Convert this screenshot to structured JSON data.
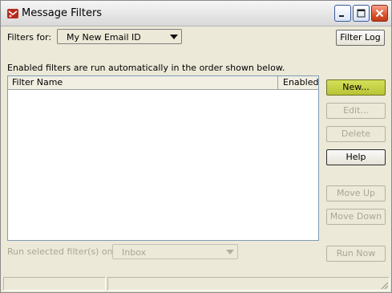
{
  "window": {
    "title": "Message Filters"
  },
  "filters_for": {
    "label": "Filters for:",
    "selected": "My New Email ID"
  },
  "buttons": {
    "filter_log": "Filter Log",
    "new": "New...",
    "edit": "Edit...",
    "delete": "Delete",
    "help": "Help",
    "move_up": "Move Up",
    "move_down": "Move Down",
    "run_now": "Run Now"
  },
  "info_text": "Enabled filters are run automatically in the order shown below.",
  "filter_list": {
    "columns": [
      "Filter Name",
      "Enabled"
    ],
    "rows": []
  },
  "run_on": {
    "label": "Run selected filter(s) on:",
    "selected": "Inbox"
  },
  "colors": {
    "window_bg": "#ece9d8",
    "primary_button": "#c2cc3e",
    "disabled_text": "#a8a696"
  }
}
